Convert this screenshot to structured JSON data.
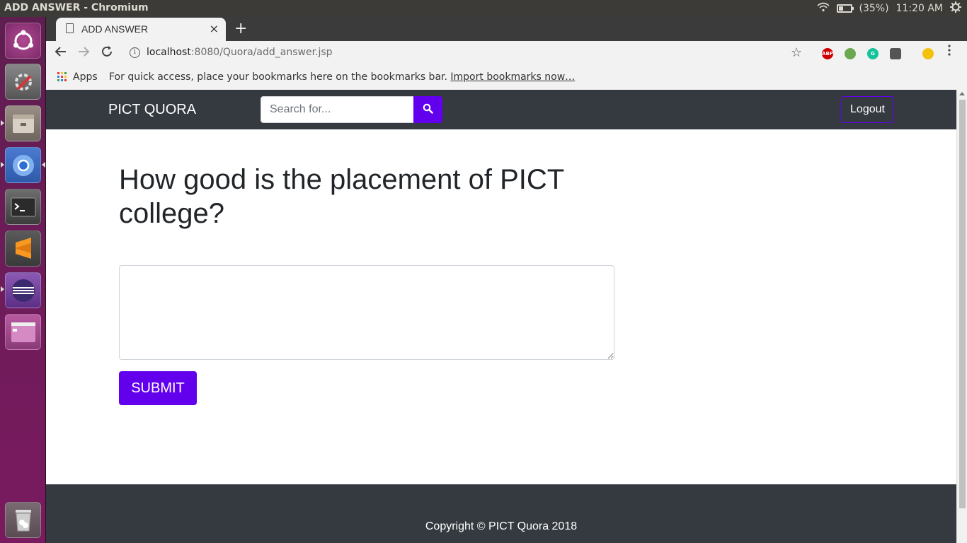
{
  "os_panel": {
    "window_title": "ADD ANSWER - Chromium",
    "battery_text": "(35%)",
    "clock": "11:20 AM"
  },
  "launcher": {
    "items": [
      "ubuntu-dash-icon",
      "system-settings-icon",
      "files-icon",
      "chromium-icon",
      "terminal-icon",
      "sublime-text-icon",
      "eclipse-icon",
      "window-app-icon",
      "trash-icon"
    ]
  },
  "browser": {
    "tab": {
      "title": "ADD ANSWER",
      "close_glyph": "×"
    },
    "new_tab_glyph": "+",
    "url": {
      "host": "localhost",
      "path": ":8080/Quora/add_answer.jsp"
    },
    "extensions": [
      "ABP",
      "extension-icon",
      "grammarly-icon",
      "extension-icon",
      "emoji-icon"
    ],
    "bookmarks_bar": {
      "apps_label": "Apps",
      "hint": "For quick access, place your bookmarks here on the bookmarks bar.",
      "import_link": "Import bookmarks now…"
    }
  },
  "site": {
    "brand": "PICT QUORA",
    "search_placeholder": "Search for...",
    "logout_label": "Logout",
    "question": "How good is the placement of PICT college?",
    "answer_value": "",
    "submit_label": "SUBMIT",
    "footer_text": "Copyright © PICT Quora 2018",
    "colors": {
      "nav_bg": "#343a40",
      "accent": "#6200ee"
    }
  }
}
